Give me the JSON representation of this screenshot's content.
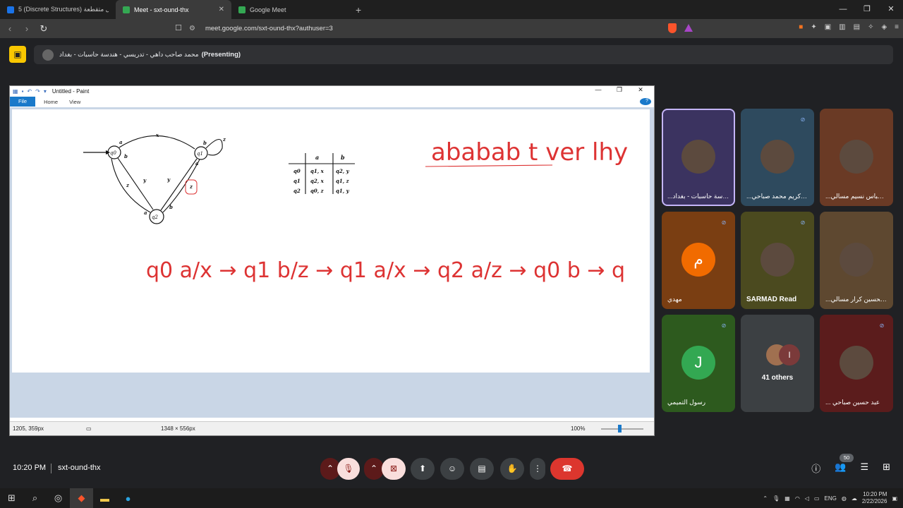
{
  "browser": {
    "tabs": [
      {
        "title": "5 (Discrete Structures) هياكل متقطعة",
        "active": false,
        "favicon_color": "#1a73e8"
      },
      {
        "title": "Meet - sxt-ound-thx",
        "active": true,
        "favicon_color": "#34a853"
      },
      {
        "title": "Google Meet",
        "active": false,
        "favicon_color": "#34a853"
      }
    ],
    "new_tab": "+",
    "url": "meet.google.com/sxt-ound-thx?authuser=3"
  },
  "presenting": {
    "presenter": "محمد صاحب داهي - تدريسي - هندسة حاسبات - بغداد",
    "suffix": "(Presenting)"
  },
  "paint": {
    "title": "Untitled - Paint",
    "menu": [
      "File",
      "Home",
      "View"
    ],
    "status_pos": "1205, 359px",
    "status_size": "1348 × 556px",
    "zoom": "100%",
    "zoom_level_percent": 100
  },
  "canvas_text": {
    "states": [
      "q0",
      "q1",
      "q2"
    ],
    "edge_labels": [
      "a",
      "x",
      "b",
      "b",
      "z",
      "y",
      "z",
      "y",
      "a",
      "a",
      "b",
      "z"
    ],
    "table_header": [
      "a",
      "b"
    ],
    "table_rows": [
      {
        "state": "q0",
        "a": "q1, x",
        "b": "q2, y"
      },
      {
        "state": "q1",
        "a": "q2, x",
        "b": "q1, z"
      },
      {
        "state": "q2",
        "a": "q0, z",
        "b": "q1, y"
      }
    ],
    "handwriting_top": "ababab t ver lhy",
    "handwriting_seq": "q0 a/x → q1 b/z → q1 a/x → q2 a/z → q0 b → q"
  },
  "participants": [
    {
      "name": "...هندسة حاسبات - بغداد",
      "type": "photo",
      "bg": "#3b3360",
      "selected": true,
      "muted": false
    },
    {
      "name": "...سي كريم محمد صباحي",
      "type": "photo",
      "bg": "#2e4a5e",
      "selected": false,
      "muted": true
    },
    {
      "name": "...الي عباس نسيم مسالي",
      "type": "photo",
      "bg": "#6a3a25",
      "selected": false,
      "muted": false
    },
    {
      "name": "مهدي",
      "type": "letter",
      "letter": "م",
      "letter_bg": "#f16b00",
      "bg": "#7a3e12",
      "muted": true
    },
    {
      "name": "SARMAD Read",
      "type": "photo",
      "bg": "#4b4a1f",
      "muted": true
    },
    {
      "name": "...يد الحسين كرار مسالي",
      "type": "photo",
      "bg": "#5e4830",
      "muted": false
    },
    {
      "name": "رسول التميمي",
      "type": "letter",
      "letter": "J",
      "letter_bg": "#33a852",
      "bg": "#2d5a1e",
      "muted": true
    },
    {
      "name": "41 others",
      "type": "others",
      "bg": "#3c4043",
      "muted": false
    },
    {
      "name": "... عبد حسين صباحي",
      "type": "photo",
      "bg": "#5b1c1c",
      "muted": true
    }
  ],
  "meetbar": {
    "time": "10:20 PM",
    "code": "sxt-ound-thx",
    "participant_count": "50"
  },
  "taskbar": {
    "lang": "ENG",
    "time": "10:20 PM",
    "date": "2/22/2026"
  }
}
